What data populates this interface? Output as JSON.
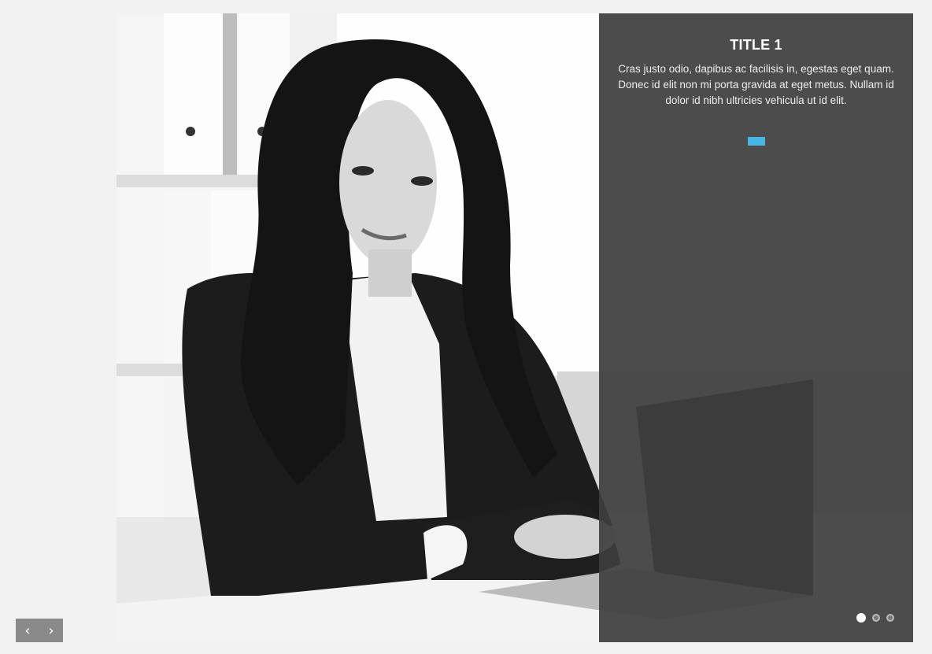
{
  "slide": {
    "title": "TITLE 1",
    "text": "Cras justo odio, dapibus ac facilisis in, egestas eget quam. Donec id elit non mi porta gravida at eget metus. Nullam id dolor id nibh ultricies vehicula ut id elit.",
    "accent_color": "#47b5e6"
  },
  "pagination": {
    "count": 3,
    "active_index": 0
  },
  "navigation": {
    "prev_label": "‹",
    "next_label": "›"
  }
}
